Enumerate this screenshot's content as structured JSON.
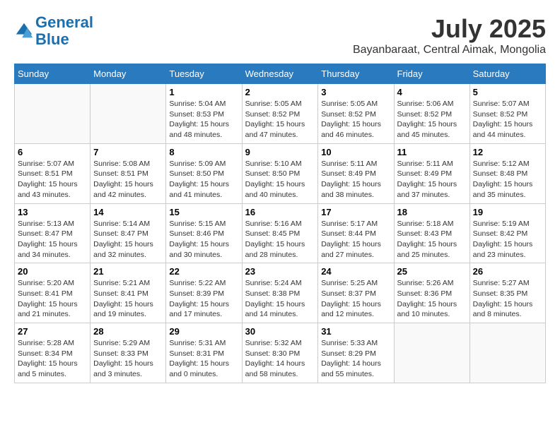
{
  "header": {
    "logo_line1": "General",
    "logo_line2": "Blue",
    "month": "July 2025",
    "location": "Bayanbaraat, Central Aimak, Mongolia"
  },
  "days_of_week": [
    "Sunday",
    "Monday",
    "Tuesday",
    "Wednesday",
    "Thursday",
    "Friday",
    "Saturday"
  ],
  "weeks": [
    [
      {
        "num": "",
        "info": ""
      },
      {
        "num": "",
        "info": ""
      },
      {
        "num": "1",
        "info": "Sunrise: 5:04 AM\nSunset: 8:53 PM\nDaylight: 15 hours\nand 48 minutes."
      },
      {
        "num": "2",
        "info": "Sunrise: 5:05 AM\nSunset: 8:52 PM\nDaylight: 15 hours\nand 47 minutes."
      },
      {
        "num": "3",
        "info": "Sunrise: 5:05 AM\nSunset: 8:52 PM\nDaylight: 15 hours\nand 46 minutes."
      },
      {
        "num": "4",
        "info": "Sunrise: 5:06 AM\nSunset: 8:52 PM\nDaylight: 15 hours\nand 45 minutes."
      },
      {
        "num": "5",
        "info": "Sunrise: 5:07 AM\nSunset: 8:52 PM\nDaylight: 15 hours\nand 44 minutes."
      }
    ],
    [
      {
        "num": "6",
        "info": "Sunrise: 5:07 AM\nSunset: 8:51 PM\nDaylight: 15 hours\nand 43 minutes."
      },
      {
        "num": "7",
        "info": "Sunrise: 5:08 AM\nSunset: 8:51 PM\nDaylight: 15 hours\nand 42 minutes."
      },
      {
        "num": "8",
        "info": "Sunrise: 5:09 AM\nSunset: 8:50 PM\nDaylight: 15 hours\nand 41 minutes."
      },
      {
        "num": "9",
        "info": "Sunrise: 5:10 AM\nSunset: 8:50 PM\nDaylight: 15 hours\nand 40 minutes."
      },
      {
        "num": "10",
        "info": "Sunrise: 5:11 AM\nSunset: 8:49 PM\nDaylight: 15 hours\nand 38 minutes."
      },
      {
        "num": "11",
        "info": "Sunrise: 5:11 AM\nSunset: 8:49 PM\nDaylight: 15 hours\nand 37 minutes."
      },
      {
        "num": "12",
        "info": "Sunrise: 5:12 AM\nSunset: 8:48 PM\nDaylight: 15 hours\nand 35 minutes."
      }
    ],
    [
      {
        "num": "13",
        "info": "Sunrise: 5:13 AM\nSunset: 8:47 PM\nDaylight: 15 hours\nand 34 minutes."
      },
      {
        "num": "14",
        "info": "Sunrise: 5:14 AM\nSunset: 8:47 PM\nDaylight: 15 hours\nand 32 minutes."
      },
      {
        "num": "15",
        "info": "Sunrise: 5:15 AM\nSunset: 8:46 PM\nDaylight: 15 hours\nand 30 minutes."
      },
      {
        "num": "16",
        "info": "Sunrise: 5:16 AM\nSunset: 8:45 PM\nDaylight: 15 hours\nand 28 minutes."
      },
      {
        "num": "17",
        "info": "Sunrise: 5:17 AM\nSunset: 8:44 PM\nDaylight: 15 hours\nand 27 minutes."
      },
      {
        "num": "18",
        "info": "Sunrise: 5:18 AM\nSunset: 8:43 PM\nDaylight: 15 hours\nand 25 minutes."
      },
      {
        "num": "19",
        "info": "Sunrise: 5:19 AM\nSunset: 8:42 PM\nDaylight: 15 hours\nand 23 minutes."
      }
    ],
    [
      {
        "num": "20",
        "info": "Sunrise: 5:20 AM\nSunset: 8:41 PM\nDaylight: 15 hours\nand 21 minutes."
      },
      {
        "num": "21",
        "info": "Sunrise: 5:21 AM\nSunset: 8:41 PM\nDaylight: 15 hours\nand 19 minutes."
      },
      {
        "num": "22",
        "info": "Sunrise: 5:22 AM\nSunset: 8:39 PM\nDaylight: 15 hours\nand 17 minutes."
      },
      {
        "num": "23",
        "info": "Sunrise: 5:24 AM\nSunset: 8:38 PM\nDaylight: 15 hours\nand 14 minutes."
      },
      {
        "num": "24",
        "info": "Sunrise: 5:25 AM\nSunset: 8:37 PM\nDaylight: 15 hours\nand 12 minutes."
      },
      {
        "num": "25",
        "info": "Sunrise: 5:26 AM\nSunset: 8:36 PM\nDaylight: 15 hours\nand 10 minutes."
      },
      {
        "num": "26",
        "info": "Sunrise: 5:27 AM\nSunset: 8:35 PM\nDaylight: 15 hours\nand 8 minutes."
      }
    ],
    [
      {
        "num": "27",
        "info": "Sunrise: 5:28 AM\nSunset: 8:34 PM\nDaylight: 15 hours\nand 5 minutes."
      },
      {
        "num": "28",
        "info": "Sunrise: 5:29 AM\nSunset: 8:33 PM\nDaylight: 15 hours\nand 3 minutes."
      },
      {
        "num": "29",
        "info": "Sunrise: 5:31 AM\nSunset: 8:31 PM\nDaylight: 15 hours\nand 0 minutes."
      },
      {
        "num": "30",
        "info": "Sunrise: 5:32 AM\nSunset: 8:30 PM\nDaylight: 14 hours\nand 58 minutes."
      },
      {
        "num": "31",
        "info": "Sunrise: 5:33 AM\nSunset: 8:29 PM\nDaylight: 14 hours\nand 55 minutes."
      },
      {
        "num": "",
        "info": ""
      },
      {
        "num": "",
        "info": ""
      }
    ]
  ]
}
